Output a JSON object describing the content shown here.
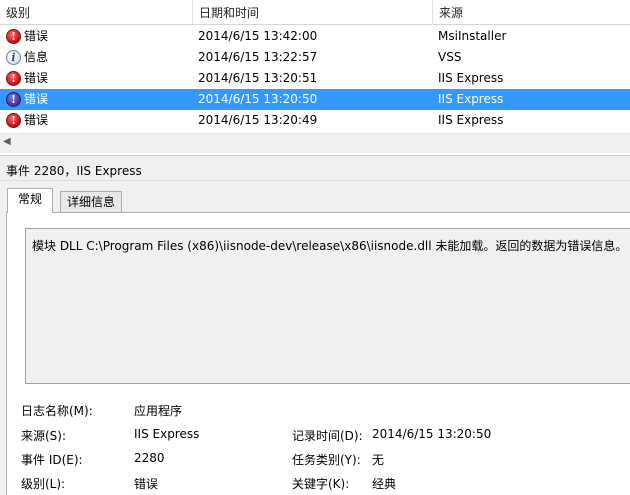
{
  "columns": {
    "level": "级别",
    "datetime": "日期和时间",
    "source": "来源"
  },
  "rows": [
    {
      "icon": "error-icon",
      "level": "错误",
      "datetime": "2014/6/15 13:42:00",
      "source": "MsiInstaller"
    },
    {
      "icon": "info-icon",
      "level": "信息",
      "datetime": "2014/6/15 13:22:57",
      "source": "VSS"
    },
    {
      "icon": "error-icon",
      "level": "错误",
      "datetime": "2014/6/15 13:20:51",
      "source": "IIS Express"
    },
    {
      "icon": "error-icon",
      "level": "错误",
      "datetime": "2014/6/15 13:20:50",
      "source": "IIS Express",
      "selected": true
    },
    {
      "icon": "error-icon",
      "level": "错误",
      "datetime": "2014/6/15 13:20:49",
      "source": "IIS Express"
    }
  ],
  "detail": {
    "title": "事件 2280，IIS Express",
    "tabs": {
      "general": "常规",
      "details": "详细信息"
    },
    "message": "模块 DLL C:\\Program Files (x86)\\iisnode-dev\\release\\x86\\iisnode.dll 未能加载。返回的数据为错误信息。",
    "props": {
      "log_name_label": "日志名称(M):",
      "log_name": "应用程序",
      "source_label": "来源(S):",
      "source": "IIS Express",
      "logged_label": "记录时间(D):",
      "logged": "2014/6/15 13:20:50",
      "event_id_label": "事件 ID(E):",
      "event_id": "2280",
      "task_label": "任务类别(Y):",
      "task": "无",
      "level_label": "级别(L):",
      "level": "错误",
      "keywords_label": "关键字(K):",
      "keywords": "经典"
    }
  },
  "colors": {
    "selection": "#3399ff",
    "error": "#c40f0f"
  }
}
